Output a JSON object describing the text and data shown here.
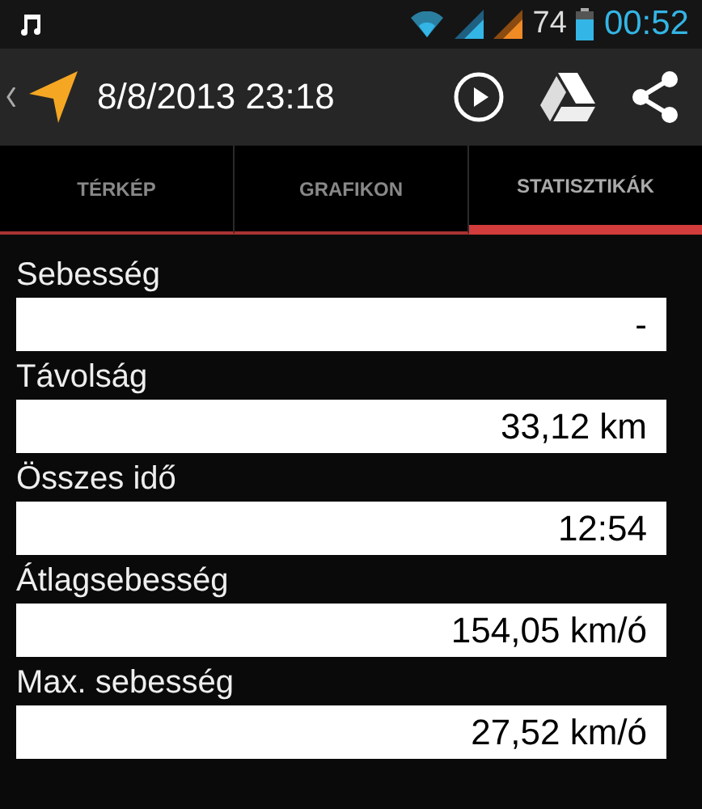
{
  "status_bar": {
    "battery": "74",
    "time": "00:52"
  },
  "action_bar": {
    "title": "8/8/2013 23:18"
  },
  "tabs": [
    {
      "label": "TÉRKÉP",
      "selected": false
    },
    {
      "label": "GRAFIKON",
      "selected": false
    },
    {
      "label": "STATISZTIKÁK",
      "selected": true
    }
  ],
  "stats": [
    {
      "label": "Sebesség",
      "value": "-"
    },
    {
      "label": "Távolság",
      "value": "33,12 km"
    },
    {
      "label": "Összes idő",
      "value": "12:54"
    },
    {
      "label": "Átlagsebesség",
      "value": "154,05 km/ó"
    },
    {
      "label": "Max. sebesség",
      "value": "27,52 km/ó"
    }
  ]
}
